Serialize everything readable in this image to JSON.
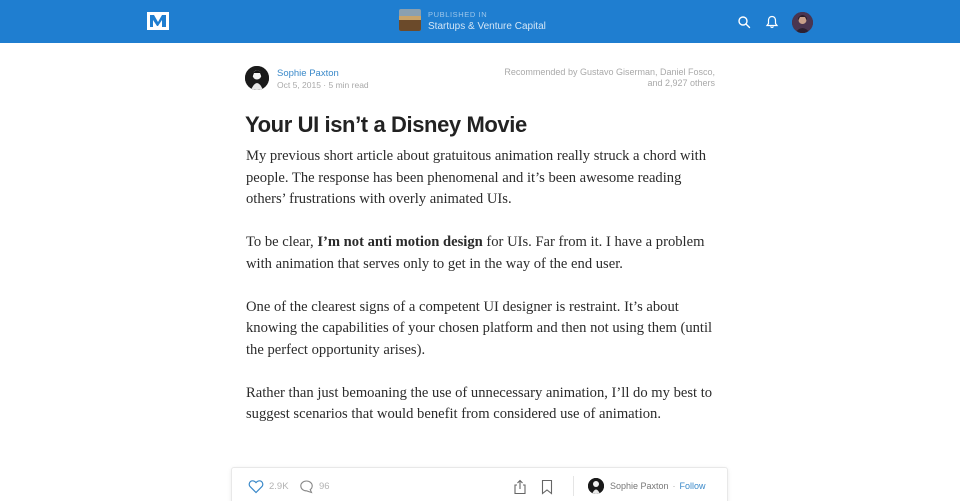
{
  "topbar": {
    "publication_kicker": "PUBLISHED IN",
    "publication_name": "Startups & Venture Capital",
    "icons": [
      "medium-logo-icon",
      "search-icon",
      "bell-icon",
      "user-avatar"
    ],
    "accent": "#1f7ed0"
  },
  "article": {
    "author": "Sophie Paxton",
    "date_read": "Oct 5, 2015 · 5 min read",
    "recommended_line1": "Recommended by Gustavo Giserman, Daniel Fosco,",
    "recommended_line2": "and 2,927 others",
    "title": "Your UI isn’t a Disney Movie",
    "p1": "My previous short article about gratuitous animation really struck a chord with people. The response has been phenomenal and it’s been awesome reading others’ frustrations with overly animated UIs.",
    "p2_a": "To be clear, ",
    "p2_bold": "I’m not anti motion design",
    "p2_b": " for UIs. Far from it. I have a problem with animation that serves only to get in the way of the end user.",
    "p3": "One of the clearest signs of a competent UI designer is restraint. It’s about knowing the capabilities of your chosen platform and then not using them (until the perfect opportunity arises).",
    "p4": "Rather than just bemoaning the use of unnecessary animation, I’ll do my best to suggest scenarios that would benefit from considered use of animation."
  },
  "actionbar": {
    "likes": "2.9K",
    "comments": "96",
    "author": "Sophie Paxton",
    "dot": "·",
    "follow_label": "Follow",
    "link_color": "#3a89c9"
  }
}
